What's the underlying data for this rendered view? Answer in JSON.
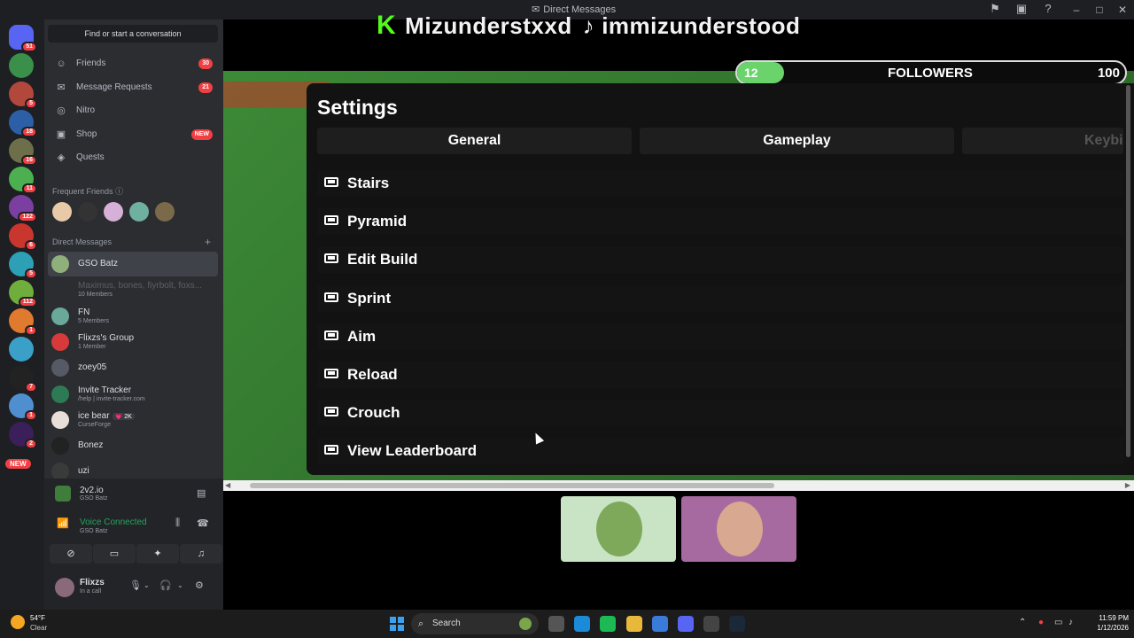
{
  "titlebar": {
    "title": "Direct Messages",
    "icons": [
      "inbox-icon",
      "screen-icon",
      "help-icon"
    ],
    "controls": [
      "minimize-icon",
      "maximize-icon",
      "close-icon"
    ]
  },
  "rail": {
    "servers": [
      {
        "badge": "51",
        "color": "#5865f2",
        "kind": "discord"
      },
      {
        "badge": "",
        "color": "#3a8f4a"
      },
      {
        "badge": "5",
        "color": "#b2473c"
      },
      {
        "badge": "18",
        "color": "#2d5fa6"
      },
      {
        "badge": "16",
        "color": "#6c6f4a"
      },
      {
        "badge": "11",
        "color": "#4caf50"
      },
      {
        "badge": "122",
        "color": "#7a3fa0"
      },
      {
        "badge": "6",
        "color": "#c8362e"
      },
      {
        "badge": "5",
        "color": "#2ea0b5"
      },
      {
        "badge": "112",
        "color": "#6fae3c"
      },
      {
        "badge": "1",
        "color": "#e07a2e"
      },
      {
        "badge": "",
        "color": "#3aa0c8"
      },
      {
        "badge": "7",
        "color": "#222222"
      },
      {
        "badge": "1",
        "color": "#4f8fd0"
      },
      {
        "badge": "2",
        "color": "#3a1f5a"
      }
    ],
    "new_label": "NEW"
  },
  "sidebar": {
    "find_label": "Find or start a conversation",
    "nav": [
      {
        "label": "Friends",
        "icon": "friends-icon",
        "glyph": "☺",
        "pill": "30"
      },
      {
        "label": "Message Requests",
        "icon": "mail-icon",
        "glyph": "✉",
        "pill": "21"
      },
      {
        "label": "Nitro",
        "icon": "nitro-icon",
        "glyph": "◎",
        "pill": ""
      },
      {
        "label": "Shop",
        "icon": "shop-icon",
        "glyph": "▣",
        "pill": "NEW"
      },
      {
        "label": "Quests",
        "icon": "quests-icon",
        "glyph": "◈",
        "pill": ""
      }
    ],
    "frequent_label": "Frequent Friends",
    "frequent_colors": [
      "#e8c9a8",
      "#333333",
      "#d7b0d8",
      "#6fb0a0",
      "#7a6a4a"
    ],
    "dm_label": "Direct Messages",
    "dm_plus": "+",
    "dms": [
      {
        "name": "GSO Batz",
        "sub": "",
        "color": "#8fb07a",
        "active": true,
        "dim": false
      },
      {
        "name": "Maximus, bones, fiyrbolt, foxs...",
        "sub": "10 Members",
        "color": "#2b2d31",
        "active": false,
        "dim": true
      },
      {
        "name": "FN",
        "sub": "5 Members",
        "color": "#6aa89a",
        "active": false,
        "dim": false
      },
      {
        "name": "Flixzs's Group",
        "sub": "1 Member",
        "color": "#d63a3a",
        "active": false,
        "dim": false
      },
      {
        "name": "zoey05",
        "sub": "",
        "color": "#555a66",
        "active": false,
        "dim": false
      },
      {
        "name": "Invite Tracker",
        "sub": "/help | invite-tracker.com",
        "color": "#2d7a55",
        "active": false,
        "dim": false
      },
      {
        "name": "ice bear",
        "sub": "CurseForge",
        "color": "#e8e0d8",
        "active": false,
        "dim": false,
        "tag": "💗 2K"
      },
      {
        "name": "Bonez",
        "sub": "",
        "color": "#222222",
        "active": false,
        "dim": false
      },
      {
        "name": "uzi",
        "sub": "",
        "color": "#3a3a3a",
        "active": false,
        "dim": false
      }
    ],
    "panel": {
      "game_name": "2v2.io",
      "game_sub": "GSO Batz",
      "voice_status": "Voice Connected",
      "voice_sub": "GSO Batz",
      "buttons": [
        "camera-off-icon",
        "screen-share-icon",
        "activities-icon",
        "soundboard-icon"
      ],
      "button_glyphs": [
        "⊘",
        "▭",
        "✦",
        "♫"
      ],
      "user_name": "Flixzs",
      "user_status": "In a call"
    }
  },
  "stream": {
    "overlay": {
      "kick_name": "Mizunderstxxd",
      "tiktok_name": "immizunderstood"
    },
    "followers": {
      "label": "FOLLOWERS",
      "current": "12",
      "goal": "100",
      "progress": 0.12
    },
    "settings": {
      "title": "Settings",
      "tabs": [
        "General",
        "Gameplay",
        "Keybi"
      ],
      "binds": [
        "Stairs",
        "Pyramid",
        "Edit Build",
        "Sprint",
        "Aim",
        "Reload",
        "Crouch",
        "View Leaderboard"
      ]
    },
    "tiles": [
      {
        "color": "#c9e4c5",
        "face": "#7fa95a"
      },
      {
        "color": "#a66aa0",
        "face": "#d8a890"
      }
    ]
  },
  "taskbar": {
    "weather_temp": "54°F",
    "weather_cond": "Clear",
    "search_label": "Search",
    "apps": [
      {
        "name": "task-view-icon",
        "color": "#555555"
      },
      {
        "name": "edge-icon",
        "color": "#1b8ad8"
      },
      {
        "name": "spotify-icon",
        "color": "#1db954"
      },
      {
        "name": "file-explorer-icon",
        "color": "#e8b83a"
      },
      {
        "name": "store-icon",
        "color": "#3a7ad8"
      },
      {
        "name": "discord-icon",
        "color": "#5865f2"
      },
      {
        "name": "chrome-icon",
        "color": "#444444"
      },
      {
        "name": "steam-icon",
        "color": "#1b2838"
      }
    ],
    "time": "11:59 PM",
    "date": "1/12/2026"
  }
}
